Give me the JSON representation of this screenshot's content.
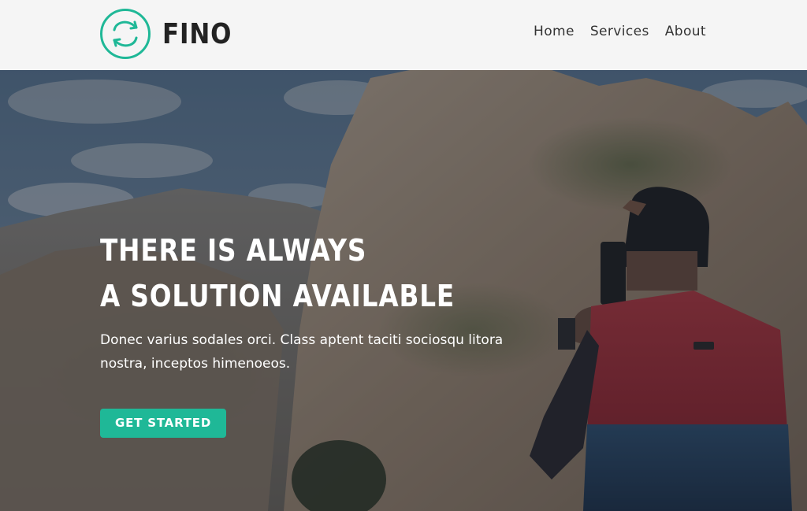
{
  "brand": {
    "name": "FINO",
    "accent_color": "#1fb897",
    "logo_icon": "exchange-arrows-circle-icon"
  },
  "nav": {
    "items": [
      {
        "label": "Home"
      },
      {
        "label": "Services"
      },
      {
        "label": "About"
      }
    ]
  },
  "hero": {
    "title_line1": "THERE IS ALWAYS",
    "title_line2": "A SOLUTION AVAILABLE",
    "description": "Donec varius sodales orci. Class aptent taciti sociosqu litora nostra, inceptos himenoeos.",
    "cta_label": "GET STARTED",
    "background_image": "mountain-photographer-image"
  }
}
